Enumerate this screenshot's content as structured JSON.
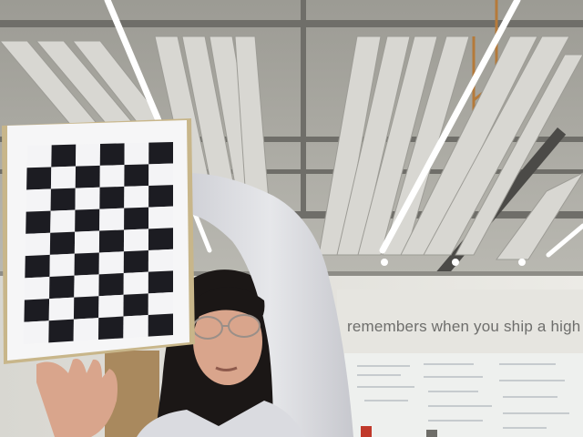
{
  "scene": {
    "wall_slogan": "remembers when you ship a high qu",
    "chessboard": {
      "rows": 9,
      "cols": 6,
      "dark_color": "#1c1c22",
      "light_color": "#f4f4f6",
      "mount_color": "#c8b68a"
    }
  },
  "colors": {
    "ceiling": "#a9a8a1",
    "slats": "#d6d5d0",
    "wall": "#e8e7e2",
    "hoodie": "#dfe0e4",
    "hair": "#1b1716",
    "skin": "#d9a58c",
    "whiteboard": "#eef0ee"
  }
}
